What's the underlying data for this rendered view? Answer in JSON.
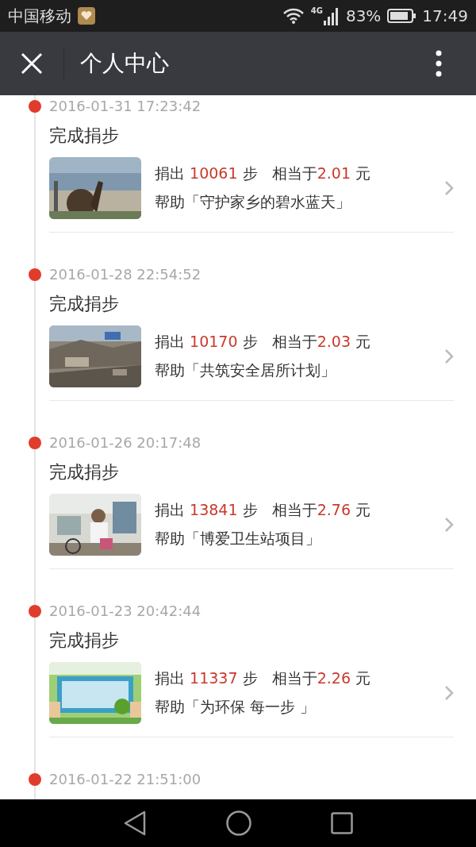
{
  "status_bar": {
    "carrier": "中国移动",
    "network": "4G",
    "battery": "83%",
    "time": "17:49"
  },
  "header": {
    "title": "个人中心"
  },
  "entries": [
    {
      "date": "2016-01-31 17:23:42",
      "title": "完成捐步",
      "donation": {
        "label": "捐出",
        "steps": "10061",
        "unit": "步",
        "equiv": "相当于",
        "amount": "2.01",
        "currency": "元"
      },
      "project": "帮助「守护家乡的碧水蓝天」"
    },
    {
      "date": "2016-01-28 22:54:52",
      "title": "完成捐步",
      "donation": {
        "label": "捐出",
        "steps": "10170",
        "unit": "步",
        "equiv": "相当于",
        "amount": "2.03",
        "currency": "元"
      },
      "project": "帮助「共筑安全居所计划」"
    },
    {
      "date": "2016-01-26 20:17:48",
      "title": "完成捐步",
      "donation": {
        "label": "捐出",
        "steps": "13841",
        "unit": "步",
        "equiv": "相当于",
        "amount": "2.76",
        "currency": "元"
      },
      "project": "帮助「博爱卫生站项目」"
    },
    {
      "date": "2016-01-23 20:42:44",
      "title": "完成捐步",
      "donation": {
        "label": "捐出",
        "steps": "11337",
        "unit": "步",
        "equiv": "相当于",
        "amount": "2.26",
        "currency": "元"
      },
      "project": "帮助「为环保 每一步 」"
    },
    {
      "date": "2016-01-22 21:51:00"
    }
  ]
}
